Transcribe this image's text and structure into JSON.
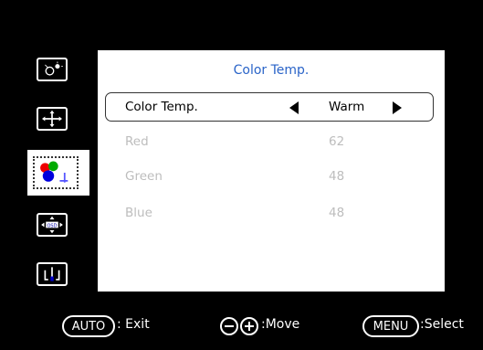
{
  "menu": {
    "icons": [
      {
        "name": "picture-brightness-icon"
      },
      {
        "name": "position-icon"
      },
      {
        "name": "color-icon"
      },
      {
        "name": "osd-settings-icon"
      },
      {
        "name": "input-setup-icon"
      }
    ],
    "selected_icon": "color-icon"
  },
  "panel": {
    "title": "Color Temp.",
    "rows": [
      {
        "label": "Color Temp.",
        "value": "Warm"
      },
      {
        "label": "Red",
        "value": "62"
      },
      {
        "label": "Green",
        "value": "48"
      },
      {
        "label": "Blue",
        "value": "48"
      }
    ]
  },
  "footer": {
    "auto_button": "AUTO",
    "auto_hint": ": Exit",
    "move_hint": ":Move",
    "menu_button": "MENU",
    "menu_hint": ":Select"
  },
  "colors": {
    "title_blue": "#2a64c8",
    "dim_text": "#bdbdbd"
  }
}
